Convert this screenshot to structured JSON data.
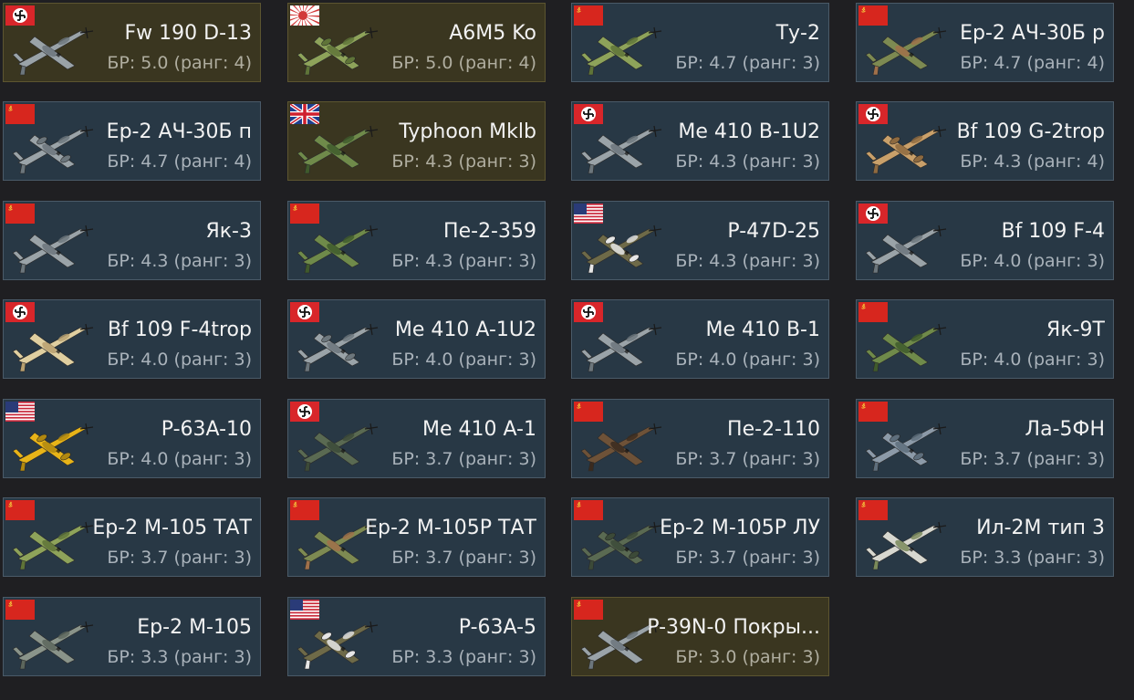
{
  "vehicles": [
    {
      "name": "Fw 190 D-13",
      "br": "БР: 5.0 (ранг: 4)",
      "nation": "germany",
      "premium": true,
      "camo": "grey"
    },
    {
      "name": "A6M5 Ko",
      "br": "БР: 5.0 (ранг: 4)",
      "nation": "japan",
      "premium": true,
      "camo": "green"
    },
    {
      "name": "Ту-2",
      "br": "БР: 4.7 (ранг: 3)",
      "nation": "ussr",
      "premium": false,
      "camo": "green"
    },
    {
      "name": "Ер-2 АЧ-30Б р",
      "br": "БР: 4.7 (ранг: 4)",
      "nation": "ussr",
      "premium": false,
      "camo": "camo-brown"
    },
    {
      "name": "Ер-2 АЧ-30Б п",
      "br": "БР: 4.7 (ранг: 4)",
      "nation": "ussr",
      "premium": false,
      "camo": "grey"
    },
    {
      "name": "Typhoon Mklb",
      "br": "БР: 4.3 (ранг: 3)",
      "nation": "uk",
      "premium": true,
      "camo": "camo-green"
    },
    {
      "name": "Me 410 B-1U2",
      "br": "БР: 4.3 (ранг: 3)",
      "nation": "germany",
      "premium": false,
      "camo": "grey"
    },
    {
      "name": "Bf 109 G-2trop",
      "br": "БР: 4.3 (ранг: 4)",
      "nation": "germany",
      "premium": false,
      "camo": "tan"
    },
    {
      "name": "Як-3",
      "br": "БР: 4.3 (ранг: 3)",
      "nation": "ussr",
      "premium": false,
      "camo": "grey"
    },
    {
      "name": "Пе-2-359",
      "br": "БР: 4.3 (ранг: 3)",
      "nation": "ussr",
      "premium": false,
      "camo": "camo-green"
    },
    {
      "name": "P-47D-25",
      "br": "БР: 4.3 (ранг: 3)",
      "nation": "usa",
      "premium": false,
      "camo": "olive"
    },
    {
      "name": "Bf 109 F-4",
      "br": "БР: 4.0 (ранг: 3)",
      "nation": "germany",
      "premium": false,
      "camo": "grey"
    },
    {
      "name": "Bf 109 F-4trop",
      "br": "БР: 4.0 (ранг: 3)",
      "nation": "germany",
      "premium": false,
      "camo": "tan-light"
    },
    {
      "name": "Me 410 A-1U2",
      "br": "БР: 4.0 (ранг: 3)",
      "nation": "germany",
      "premium": false,
      "camo": "grey"
    },
    {
      "name": "Me 410 B-1",
      "br": "БР: 4.0 (ранг: 3)",
      "nation": "germany",
      "premium": false,
      "camo": "grey"
    },
    {
      "name": "Як-9Т",
      "br": "БР: 4.0 (ранг: 3)",
      "nation": "ussr",
      "premium": false,
      "camo": "camo-green"
    },
    {
      "name": "P-63A-10",
      "br": "БР: 4.0 (ранг: 3)",
      "nation": "usa",
      "premium": false,
      "camo": "yellow"
    },
    {
      "name": "Me 410 A-1",
      "br": "БР: 3.7 (ранг: 3)",
      "nation": "germany",
      "premium": false,
      "camo": "dark-green"
    },
    {
      "name": "Пе-2-110",
      "br": "БР: 3.7 (ранг: 3)",
      "nation": "ussr",
      "premium": false,
      "camo": "brown"
    },
    {
      "name": "Ла-5ФН",
      "br": "БР: 3.7 (ранг: 3)",
      "nation": "ussr",
      "premium": false,
      "camo": "grey-blue"
    },
    {
      "name": "Ер-2 М-105 ТАТ",
      "br": "БР: 3.7 (ранг: 3)",
      "nation": "ussr",
      "premium": false,
      "camo": "green"
    },
    {
      "name": "Ер-2 М-105Р ТАТ",
      "br": "БР: 3.7 (ранг: 3)",
      "nation": "ussr",
      "premium": false,
      "camo": "camo-brown"
    },
    {
      "name": "Ер-2 М-105Р ЛУ",
      "br": "БР: 3.7 (ранг: 3)",
      "nation": "ussr",
      "premium": false,
      "camo": "dark-green"
    },
    {
      "name": "Ил-2М тип 3",
      "br": "БР: 3.3 (ранг: 3)",
      "nation": "ussr",
      "premium": false,
      "camo": "white-camo"
    },
    {
      "name": "Ер-2 М-105",
      "br": "БР: 3.3 (ранг: 3)",
      "nation": "ussr",
      "premium": false,
      "camo": "grey-green"
    },
    {
      "name": "P-63A-5",
      "br": "БР: 3.3 (ранг: 3)",
      "nation": "usa",
      "premium": false,
      "camo": "olive"
    },
    {
      "name": "P-39N-0 Покры...",
      "br": "БР: 3.0 (ранг: 3)",
      "nation": "ussr",
      "premium": true,
      "camo": "grey"
    }
  ],
  "palette": {
    "card_bg": "#283845",
    "card_border": "#4a5a68",
    "premium_bg": "#3a3620",
    "premium_border": "#5c5530",
    "name_color": "#f2f2f2",
    "br_color": "#a9b2ba"
  }
}
